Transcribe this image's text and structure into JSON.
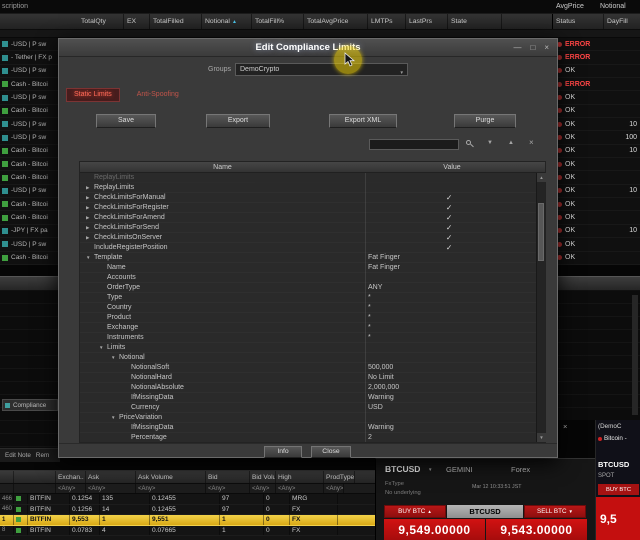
{
  "icons": {
    "minimize": "—",
    "maximize": "□",
    "close": "×",
    "chevron_down": "▼",
    "chevron_up": "▲",
    "filter": "▼",
    "dot": "●"
  },
  "top": {
    "partial_header": "scription",
    "columns": [
      {
        "label": "TotalQty",
        "sort": ""
      },
      {
        "label": "EX",
        "sort": ""
      },
      {
        "label": "TotalFilled",
        "sort": ""
      },
      {
        "label": "Notional",
        "sort": "▲"
      },
      {
        "label": "TotalFill%",
        "sort": ""
      },
      {
        "label": "TotalAvgPrice",
        "sort": ""
      },
      {
        "label": "LMTPs",
        "sort": ""
      },
      {
        "label": "LastPrs",
        "sort": ""
      },
      {
        "label": "State",
        "sort": ""
      },
      {
        "label": "Status",
        "sort": ""
      },
      {
        "label": "DayFill",
        "sort": ""
      }
    ]
  },
  "left_panel": {
    "rows": [
      {
        "icon": "#2f8f8f",
        "label": "-USD | P sw"
      },
      {
        "icon": "#2f8f8f",
        "label": "- Tether | FX p"
      },
      {
        "icon": "#2f8f8f",
        "label": "-USD | P sw"
      },
      {
        "icon": "#3f9f3f",
        "label": "Cash - Bitcoi"
      },
      {
        "icon": "#2f8f8f",
        "label": "-USD | P sw"
      },
      {
        "icon": "#3f9f3f",
        "label": "Cash - Bitcoi"
      },
      {
        "icon": "#2f8f8f",
        "label": "-USD | P sw"
      },
      {
        "icon": "#2f8f8f",
        "label": "-USD | P sw"
      },
      {
        "icon": "#3f9f3f",
        "label": "Cash - Bitcoi"
      },
      {
        "icon": "#3f9f3f",
        "label": "Cash - Bitcoi"
      },
      {
        "icon": "#3f9f3f",
        "label": "Cash - Bitcoi"
      },
      {
        "icon": "#2f8f8f",
        "label": "-USD | P sw"
      },
      {
        "icon": "#3f9f3f",
        "label": "Cash - Bitcoi"
      },
      {
        "icon": "#3f9f3f",
        "label": "Cash - Bitcoi"
      },
      {
        "icon": "#2f8f8f",
        "label": "-JPY | FX pa"
      },
      {
        "icon": "#2f8f8f",
        "label": "-USD | P sw"
      },
      {
        "icon": "#3f9f3f",
        "label": "Cash - Bitcoi"
      }
    ],
    "compliance_tab": "Compliance",
    "note_button": "Edit Note",
    "rem_button": "Rem"
  },
  "right_panel": {
    "avgprice_header": "AvgPrice",
    "notional_header": "Notional",
    "rows": [
      {
        "status": "ERROR",
        "dayfill": ""
      },
      {
        "status": "ERROR",
        "dayfill": ""
      },
      {
        "status": "OK",
        "dayfill": ""
      },
      {
        "status": "ERROR",
        "dayfill": ""
      },
      {
        "status": "OK",
        "dayfill": ""
      },
      {
        "status": "OK",
        "dayfill": ""
      },
      {
        "status": "OK",
        "dayfill": "10"
      },
      {
        "status": "OK",
        "dayfill": "100"
      },
      {
        "status": "OK",
        "dayfill": "10"
      },
      {
        "status": "OK",
        "dayfill": ""
      },
      {
        "status": "OK",
        "dayfill": ""
      },
      {
        "status": "OK",
        "dayfill": "10"
      },
      {
        "status": "OK",
        "dayfill": ""
      },
      {
        "status": "OK",
        "dayfill": ""
      },
      {
        "status": "OK",
        "dayfill": "10"
      },
      {
        "status": "OK",
        "dayfill": ""
      },
      {
        "status": "OK",
        "dayfill": ""
      }
    ]
  },
  "modal": {
    "title": "Edit Compliance Limits",
    "groups_label": "Groups",
    "groups_value": "DemoCrypto",
    "tabs": [
      {
        "label": "Static Limits",
        "active": true
      },
      {
        "label": "Anti-Spoofing",
        "active": false
      }
    ],
    "toolbar_buttons": [
      {
        "label": "Save"
      },
      {
        "label": "Export"
      },
      {
        "label": "Export XML"
      },
      {
        "label": "Purge"
      }
    ],
    "search_value": "",
    "grid": {
      "name_header": "Name",
      "value_header": "Value",
      "rows": [
        {
          "label": "ReplayLimits",
          "value": "",
          "ind": 0,
          "arrow": "",
          "check": "",
          "dim": true
        },
        {
          "label": "ReplayLimits",
          "value": "",
          "ind": 0,
          "arrow": "▶",
          "check": ""
        },
        {
          "label": "CheckLimitsForManual",
          "value": "",
          "ind": 0,
          "arrow": "▶",
          "check": "✓"
        },
        {
          "label": "CheckLimitsForRegister",
          "value": "",
          "ind": 0,
          "arrow": "▶",
          "check": "✓"
        },
        {
          "label": "CheckLimitsForAmend",
          "value": "",
          "ind": 0,
          "arrow": "▶",
          "check": "✓"
        },
        {
          "label": "CheckLimitsForSend",
          "value": "",
          "ind": 0,
          "arrow": "▶",
          "check": "✓"
        },
        {
          "label": "CheckLimitsOnServer",
          "value": "",
          "ind": 0,
          "arrow": "▶",
          "check": "✓"
        },
        {
          "label": "IncludeRegisterPosition",
          "value": "",
          "ind": 0,
          "arrow": "",
          "check": "✓"
        },
        {
          "label": "Template",
          "value": "Fat Finger",
          "ind": 0,
          "arrow": "▼",
          "check": ""
        },
        {
          "label": "Name",
          "value": "Fat Finger",
          "ind": 1,
          "arrow": "",
          "check": ""
        },
        {
          "label": "Accounts",
          "value": "",
          "ind": 1,
          "arrow": "",
          "check": ""
        },
        {
          "label": "OrderType",
          "value": "ANY",
          "ind": 1,
          "arrow": "",
          "check": ""
        },
        {
          "label": "Type",
          "value": "*",
          "ind": 1,
          "arrow": "",
          "check": ""
        },
        {
          "label": "Country",
          "value": "*",
          "ind": 1,
          "arrow": "",
          "check": ""
        },
        {
          "label": "Product",
          "value": "*",
          "ind": 1,
          "arrow": "",
          "check": ""
        },
        {
          "label": "Exchange",
          "value": "*",
          "ind": 1,
          "arrow": "",
          "check": ""
        },
        {
          "label": "Instruments",
          "value": "*",
          "ind": 1,
          "arrow": "",
          "check": ""
        },
        {
          "label": "Limits",
          "value": "",
          "ind": 1,
          "arrow": "▼",
          "check": ""
        },
        {
          "label": "Notional",
          "value": "",
          "ind": 2,
          "arrow": "▼",
          "check": ""
        },
        {
          "label": "NotionalSoft",
          "value": "500,000",
          "ind": 3,
          "arrow": "",
          "check": ""
        },
        {
          "label": "NotionalHard",
          "value": "No Limit",
          "ind": 3,
          "arrow": "",
          "check": ""
        },
        {
          "label": "NotionalAbsolute",
          "value": "2,000,000",
          "ind": 3,
          "arrow": "",
          "check": ""
        },
        {
          "label": "IfMissingData",
          "value": "Warning",
          "ind": 3,
          "arrow": "",
          "check": ""
        },
        {
          "label": "Currency",
          "value": "USD",
          "ind": 3,
          "arrow": "",
          "check": ""
        },
        {
          "label": "PriceVariation",
          "value": "",
          "ind": 2,
          "arrow": "▼",
          "check": "",
          "sel": true
        },
        {
          "label": "IfMissingData",
          "value": "Warning",
          "ind": 3,
          "arrow": "",
          "check": ""
        },
        {
          "label": "Percentage",
          "value": "2",
          "ind": 3,
          "arrow": "",
          "check": ""
        }
      ]
    },
    "footer_buttons": [
      {
        "label": "Info"
      },
      {
        "label": "Close"
      }
    ]
  },
  "bottom_table": {
    "headers": [
      "",
      "",
      "Exchan..",
      "Ask",
      "Ask Volume",
      "Bid",
      "Bid Volume",
      "High",
      "ProdType"
    ],
    "filters": [
      "",
      "",
      "<Any>",
      "<Any>",
      "<Any>",
      "<Any>",
      "<Any>",
      "<Any>",
      "<Any>"
    ],
    "rows": [
      {
        "num": "466",
        "icon": "#3f9f3f",
        "exch": "BITFIN",
        "ask": "0.1254",
        "askvol": "135",
        "bid": "0.12455",
        "bidvol": "97",
        "high": "0",
        "prod": "MRG",
        "hl": false
      },
      {
        "num": "460",
        "icon": "#3f9f3f",
        "exch": "BITFIN",
        "ask": "0.1256",
        "askvol": "14",
        "bid": "0.12455",
        "bidvol": "97",
        "high": "0",
        "prod": "FX",
        "hl": false
      },
      {
        "num": "1",
        "icon": "#3f9f3f",
        "exch": "BITFIN",
        "ask": "9,553",
        "askvol": "1",
        "bid": "9,551",
        "bidvol": "1",
        "high": "0",
        "prod": "FX",
        "hl": true
      },
      {
        "num": "8",
        "icon": "#3f9f3f",
        "exch": "BITFIN",
        "ask": "0.0783",
        "askvol": "4",
        "bid": "0.07665",
        "bidvol": "1",
        "high": "0",
        "prod": "FX",
        "hl": false
      }
    ]
  },
  "ticket": {
    "symbol": "BTCUSD",
    "venue": "GEMINI",
    "asset_class": "Forex",
    "fx_type_label": "FxType",
    "underlying_note": "No underlying",
    "timestamp": "Mar 12 10:33:51 JST",
    "buy_label": "BUY BTC",
    "sell_label": "SELL BTC",
    "mid_symbol": "BTCUSD",
    "buy_price": "9,549.00000",
    "sell_price": "9,543.00000"
  },
  "mini_panel": {
    "title": "(DemoC",
    "coin": "Bitcoin -",
    "symbol": "BTCUSD",
    "type": "SPOT",
    "buy_label": "BUY BTC",
    "price_partial": "9,5"
  }
}
